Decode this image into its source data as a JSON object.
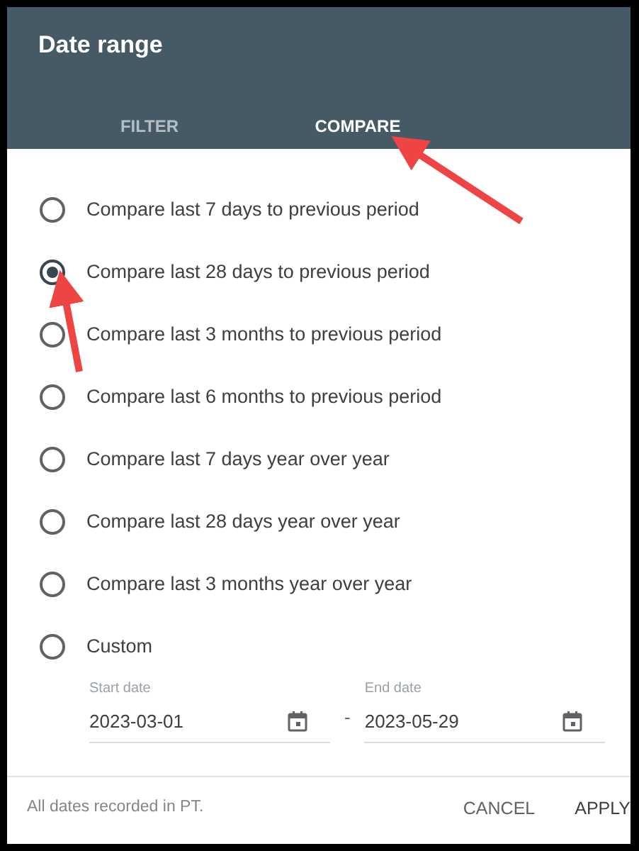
{
  "dialog": {
    "title": "Date range"
  },
  "tabs": [
    {
      "label": "FILTER",
      "selected": false
    },
    {
      "label": "COMPARE",
      "selected": true
    }
  ],
  "options": [
    {
      "label": "Compare last 7 days to previous period",
      "selected": false
    },
    {
      "label": "Compare last 28 days to previous period",
      "selected": true
    },
    {
      "label": "Compare last 3 months to previous period",
      "selected": false
    },
    {
      "label": "Compare last 6 months to previous period",
      "selected": false
    },
    {
      "label": "Compare last 7 days year over year",
      "selected": false
    },
    {
      "label": "Compare last 28 days year over year",
      "selected": false
    },
    {
      "label": "Compare last 3 months year over year",
      "selected": false
    },
    {
      "label": "Custom",
      "selected": false
    }
  ],
  "custom_range": {
    "start": {
      "label": "Start date",
      "value": "2023-03-01"
    },
    "separator": "-",
    "end": {
      "label": "End date",
      "value": "2023-05-29"
    }
  },
  "footer": {
    "note": "All dates recorded in PT.",
    "buttons": [
      "CANCEL",
      "APPLY"
    ]
  }
}
